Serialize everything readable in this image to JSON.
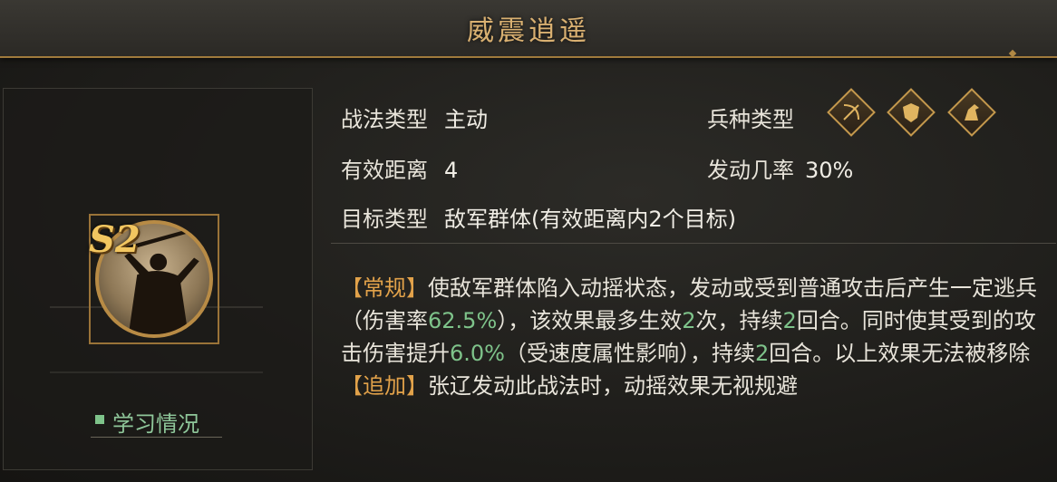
{
  "title": "威震逍遥",
  "portrait": {
    "tier": "S2"
  },
  "learn": {
    "label": "学习情况"
  },
  "fields": {
    "tactic_type_label": "战法类型",
    "tactic_type_value": "主动",
    "range_label": "有效距离",
    "range_value": "4",
    "target_label": "目标类型",
    "target_value": "敌军群体(有效距离内2个目标)",
    "troop_label": "兵种类型",
    "rate_label": "发动几率",
    "rate_value": "30%"
  },
  "troop_icons": [
    "archer-icon",
    "shield-icon",
    "cavalry-icon"
  ],
  "description": {
    "tag1": "【常规】",
    "p1a": "使敌军群体陷入动摇状态，发动或受到普通攻击后产生一定逃兵（伤害率",
    "n1": "62.5%",
    "p1b": "），该效果最多生效",
    "n2": "2",
    "p1c": "次，持续",
    "n3": "2",
    "p1d": "回合。同时使其受到的攻击伤害提升",
    "n4": "6.0%",
    "p1e": "（受速度属性影响），持续",
    "n5": "2",
    "p1f": "回合。以上效果无法被移除",
    "tag2": "【追加】",
    "p2": "张辽发动此战法时，动摇效果无视规避"
  },
  "colors": {
    "accent": "#d9b071",
    "highlight": "#7ec38a",
    "tag": "#e2a24a"
  }
}
